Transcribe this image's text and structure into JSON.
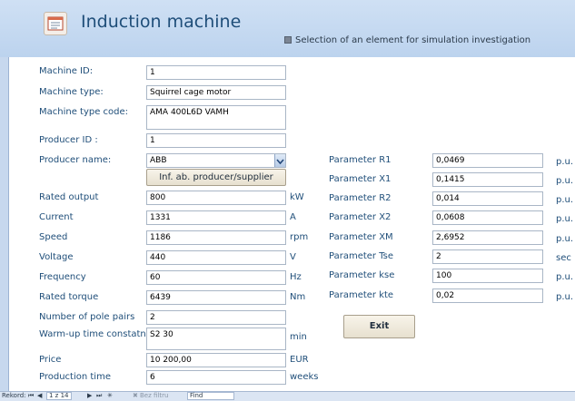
{
  "header": {
    "title": "Induction machine",
    "checkbox_label": "Selection of an element for simulation investigation"
  },
  "left_fields": [
    {
      "label": "Machine ID:",
      "value": "1",
      "unit": ""
    },
    {
      "label": "Machine type:",
      "value": "Squirrel cage motor",
      "unit": ""
    },
    {
      "label": "Machine type code:",
      "value": "AMA 400L6D VAMH",
      "unit": ""
    },
    {
      "label": "Producer ID :",
      "value": "1",
      "unit": ""
    },
    {
      "label": "Producer name:",
      "value": "ABB",
      "unit": ""
    },
    {
      "label": "Rated output",
      "value": "800",
      "unit": "kW"
    },
    {
      "label": "Current",
      "value": "1331",
      "unit": "A"
    },
    {
      "label": "Speed",
      "value": "1186",
      "unit": "rpm"
    },
    {
      "label": "Voltage",
      "value": "440",
      "unit": "V"
    },
    {
      "label": "Frequency",
      "value": "60",
      "unit": "Hz"
    },
    {
      "label": "Rated torque",
      "value": "6439",
      "unit": "Nm"
    },
    {
      "label": "Number of pole pairs",
      "value": "2",
      "unit": ""
    },
    {
      "label": "Warm-up time constatnt",
      "value": "S2 30",
      "unit": "min"
    },
    {
      "label": "Price",
      "value": "10 200,00",
      "unit": "EUR"
    },
    {
      "label": "Production time",
      "value": "6",
      "unit": "weeks"
    }
  ],
  "producer_button_label": "Inf. ab. producer/supplier",
  "parameters": [
    {
      "label": "Parameter R1",
      "value": "0,0469",
      "unit": "p.u."
    },
    {
      "label": "Parameter X1",
      "value": "0,1415",
      "unit": "p.u."
    },
    {
      "label": "Parameter R2",
      "value": "0,014",
      "unit": "p.u."
    },
    {
      "label": "Parameter X2",
      "value": "0,0608",
      "unit": "p.u."
    },
    {
      "label": "Parameter XM",
      "value": "2,6952",
      "unit": "p.u."
    },
    {
      "label": "Parameter Tse",
      "value": "2",
      "unit": "sec"
    },
    {
      "label": "Parameter kse",
      "value": "100",
      "unit": "p.u."
    },
    {
      "label": "Parameter kte",
      "value": "0,02",
      "unit": "p.u."
    }
  ],
  "exit_label": "Exit",
  "statusbar": {
    "record_label": "Rekord:",
    "record_position": "1 z 14",
    "filter_label": "Bez filtru",
    "search_label": "Find"
  }
}
